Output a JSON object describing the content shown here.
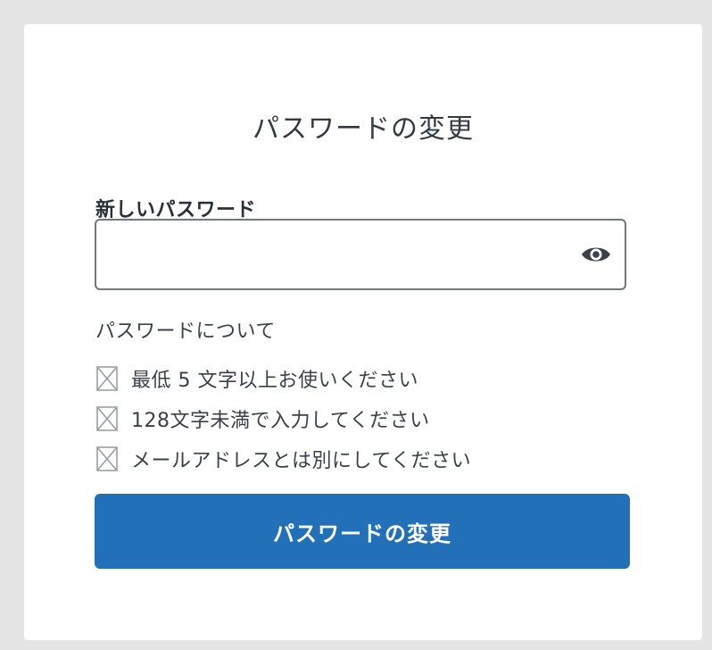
{
  "form": {
    "title": "パスワードの変更",
    "new_password_label": "新しいパスワード",
    "new_password_value": "",
    "visibility_icon": "eye-icon",
    "requirements_heading": "パスワードについて",
    "requirements": [
      {
        "text": "最低 5 文字以上お使いください",
        "icon": "checkbox-unchecked-icon"
      },
      {
        "text": "128文字未満で入力してください",
        "icon": "checkbox-unchecked-icon"
      },
      {
        "text": "メールアドレスとは別にしてください",
        "icon": "checkbox-unchecked-icon"
      }
    ],
    "submit_label": "パスワードの変更"
  },
  "colors": {
    "primary_button": "#2271b8",
    "input_border": "#6f7780",
    "background_frame": "#e4e4e4",
    "text": "#3a4148"
  }
}
